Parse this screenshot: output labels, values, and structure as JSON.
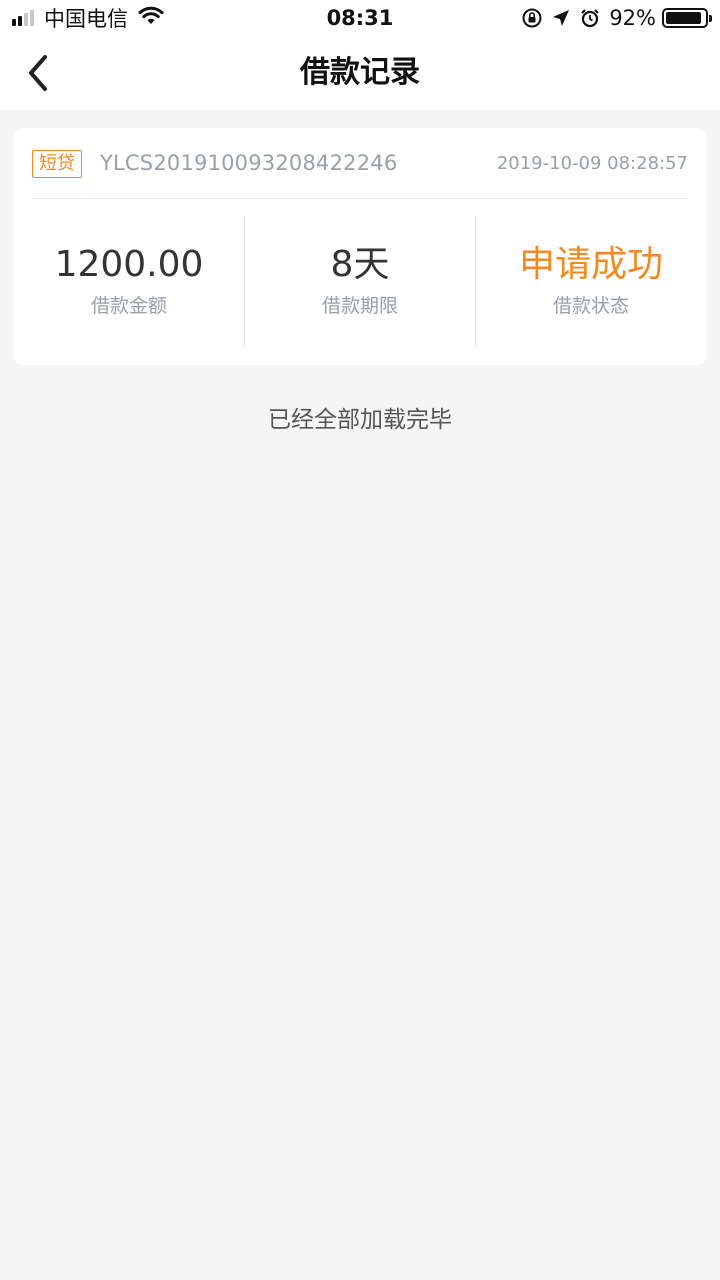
{
  "status_bar": {
    "carrier": "中国电信",
    "time": "08:31",
    "battery_percent_label": "92%",
    "battery_level": 0.92,
    "icons": [
      "signal-icon",
      "wifi-icon",
      "orientation-lock-icon",
      "location-icon",
      "alarm-icon",
      "battery-icon"
    ]
  },
  "nav": {
    "title": "借款记录",
    "back_icon": "chevron-left-icon"
  },
  "records": [
    {
      "tag": "短贷",
      "order_no": "YLCS201910093208422246",
      "datetime": "2019-10-09 08:28:57",
      "amount": "1200.00",
      "amount_label": "借款金额",
      "term": "8天",
      "term_label": "借款期限",
      "status": "申请成功",
      "status_label": "借款状态"
    }
  ],
  "list_footer": "已经全部加载完毕",
  "colors": {
    "accent": "#f28a1e",
    "background": "#f5f5f6",
    "muted_text": "#9aa0a8"
  }
}
